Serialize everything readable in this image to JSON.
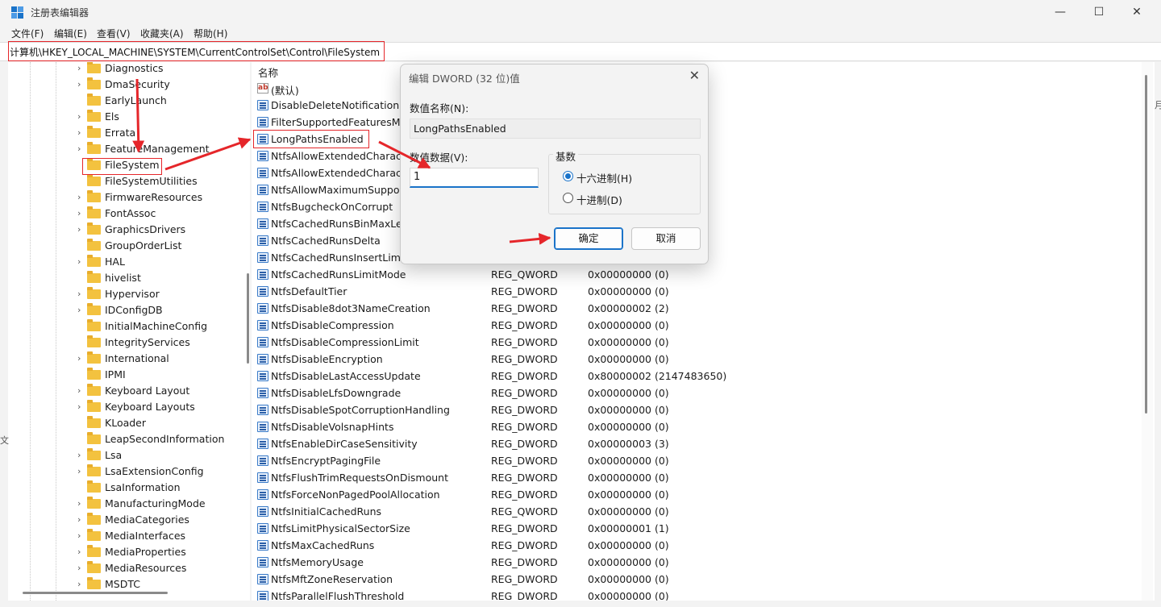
{
  "window": {
    "title": "注册表编辑器",
    "minimize_glyph": "—",
    "maximize_glyph": "☐",
    "close_glyph": "✕"
  },
  "menu": [
    "文件(F)",
    "编辑(E)",
    "查看(V)",
    "收藏夹(A)",
    "帮助(H)"
  ],
  "address": "计算机\\HKEY_LOCAL_MACHINE\\SYSTEM\\CurrentControlSet\\Control\\FileSystem",
  "tree": {
    "items": [
      {
        "label": "Diagnostics",
        "expandable": true
      },
      {
        "label": "DmaSecurity",
        "expandable": true
      },
      {
        "label": "EarlyLaunch",
        "expandable": false
      },
      {
        "label": "Els",
        "expandable": true
      },
      {
        "label": "Errata",
        "expandable": true
      },
      {
        "label": "FeatureManagement",
        "expandable": true
      },
      {
        "label": "FileSystem",
        "expandable": false,
        "selected": true
      },
      {
        "label": "FileSystemUtilities",
        "expandable": false
      },
      {
        "label": "FirmwareResources",
        "expandable": true
      },
      {
        "label": "FontAssoc",
        "expandable": true
      },
      {
        "label": "GraphicsDrivers",
        "expandable": true
      },
      {
        "label": "GroupOrderList",
        "expandable": false
      },
      {
        "label": "HAL",
        "expandable": true
      },
      {
        "label": "hivelist",
        "expandable": false
      },
      {
        "label": "Hypervisor",
        "expandable": true
      },
      {
        "label": "IDConfigDB",
        "expandable": true
      },
      {
        "label": "InitialMachineConfig",
        "expandable": false
      },
      {
        "label": "IntegrityServices",
        "expandable": false
      },
      {
        "label": "International",
        "expandable": true
      },
      {
        "label": "IPMI",
        "expandable": false
      },
      {
        "label": "Keyboard Layout",
        "expandable": true
      },
      {
        "label": "Keyboard Layouts",
        "expandable": true
      },
      {
        "label": "KLoader",
        "expandable": false
      },
      {
        "label": "LeapSecondInformation",
        "expandable": false
      },
      {
        "label": "Lsa",
        "expandable": true
      },
      {
        "label": "LsaExtensionConfig",
        "expandable": true
      },
      {
        "label": "LsaInformation",
        "expandable": false
      },
      {
        "label": "ManufacturingMode",
        "expandable": true
      },
      {
        "label": "MediaCategories",
        "expandable": true
      },
      {
        "label": "MediaInterfaces",
        "expandable": true
      },
      {
        "label": "MediaProperties",
        "expandable": true
      },
      {
        "label": "MediaResources",
        "expandable": true
      },
      {
        "label": "MSDTC",
        "expandable": true
      }
    ]
  },
  "list": {
    "col_name": "名称",
    "rows": [
      {
        "name": "(默认)",
        "type": "",
        "data": "",
        "icon": "ab"
      },
      {
        "name": "DisableDeleteNotification",
        "type": "",
        "data": ""
      },
      {
        "name": "FilterSupportedFeaturesMo",
        "type": "",
        "data": ""
      },
      {
        "name": "LongPathsEnabled",
        "type": "",
        "data": "",
        "highlight": true
      },
      {
        "name": "NtfsAllowExtendedCharacte",
        "type": "",
        "data": ""
      },
      {
        "name": "NtfsAllowExtendedCharacte",
        "type": "",
        "data": ""
      },
      {
        "name": "NtfsAllowMaximumSupport",
        "type": "",
        "data": ""
      },
      {
        "name": "NtfsBugcheckOnCorrupt",
        "type": "",
        "data": ""
      },
      {
        "name": "NtfsCachedRunsBinMaxLeng",
        "type": "",
        "data": ""
      },
      {
        "name": "NtfsCachedRunsDelta",
        "type": "",
        "data": ""
      },
      {
        "name": "NtfsCachedRunsInsertLimit",
        "type": "",
        "data": ""
      },
      {
        "name": "NtfsCachedRunsLimitMode",
        "type": "REG_QWORD",
        "data": "0x00000000 (0)"
      },
      {
        "name": "NtfsDefaultTier",
        "type": "REG_DWORD",
        "data": "0x00000000 (0)"
      },
      {
        "name": "NtfsDisable8dot3NameCreation",
        "type": "REG_DWORD",
        "data": "0x00000002 (2)"
      },
      {
        "name": "NtfsDisableCompression",
        "type": "REG_DWORD",
        "data": "0x00000000 (0)"
      },
      {
        "name": "NtfsDisableCompressionLimit",
        "type": "REG_DWORD",
        "data": "0x00000000 (0)"
      },
      {
        "name": "NtfsDisableEncryption",
        "type": "REG_DWORD",
        "data": "0x00000000 (0)"
      },
      {
        "name": "NtfsDisableLastAccessUpdate",
        "type": "REG_DWORD",
        "data": "0x80000002 (2147483650)"
      },
      {
        "name": "NtfsDisableLfsDowngrade",
        "type": "REG_DWORD",
        "data": "0x00000000 (0)"
      },
      {
        "name": "NtfsDisableSpotCorruptionHandling",
        "type": "REG_DWORD",
        "data": "0x00000000 (0)"
      },
      {
        "name": "NtfsDisableVolsnapHints",
        "type": "REG_DWORD",
        "data": "0x00000000 (0)"
      },
      {
        "name": "NtfsEnableDirCaseSensitivity",
        "type": "REG_DWORD",
        "data": "0x00000003 (3)"
      },
      {
        "name": "NtfsEncryptPagingFile",
        "type": "REG_DWORD",
        "data": "0x00000000 (0)"
      },
      {
        "name": "NtfsFlushTrimRequestsOnDismount",
        "type": "REG_DWORD",
        "data": "0x00000000 (0)"
      },
      {
        "name": "NtfsForceNonPagedPoolAllocation",
        "type": "REG_DWORD",
        "data": "0x00000000 (0)"
      },
      {
        "name": "NtfsInitialCachedRuns",
        "type": "REG_QWORD",
        "data": "0x00000000 (0)"
      },
      {
        "name": "NtfsLimitPhysicalSectorSize",
        "type": "REG_DWORD",
        "data": "0x00000001 (1)"
      },
      {
        "name": "NtfsMaxCachedRuns",
        "type": "REG_DWORD",
        "data": "0x00000000 (0)"
      },
      {
        "name": "NtfsMemoryUsage",
        "type": "REG_DWORD",
        "data": "0x00000000 (0)"
      },
      {
        "name": "NtfsMftZoneReservation",
        "type": "REG_DWORD",
        "data": "0x00000000 (0)"
      },
      {
        "name": "NtfsParallelFlushThreshold",
        "type": "REG_DWORD",
        "data": "0x00000000 (0)"
      }
    ]
  },
  "dialog": {
    "title": "编辑 DWORD (32 位)值",
    "name_label": "数值名称(N):",
    "name_value": "LongPathsEnabled",
    "data_label": "数值数据(V):",
    "data_value": "1",
    "base_label": "基数",
    "hex_label": "十六进制(H)",
    "dec_label": "十进制(D)",
    "ok_label": "确定",
    "cancel_label": "取消",
    "close_glyph": "✕"
  },
  "colors": {
    "annotation_red": "#e5262a",
    "accent_blue": "#1a73c9",
    "folder_yellow": "#f3c23f"
  }
}
